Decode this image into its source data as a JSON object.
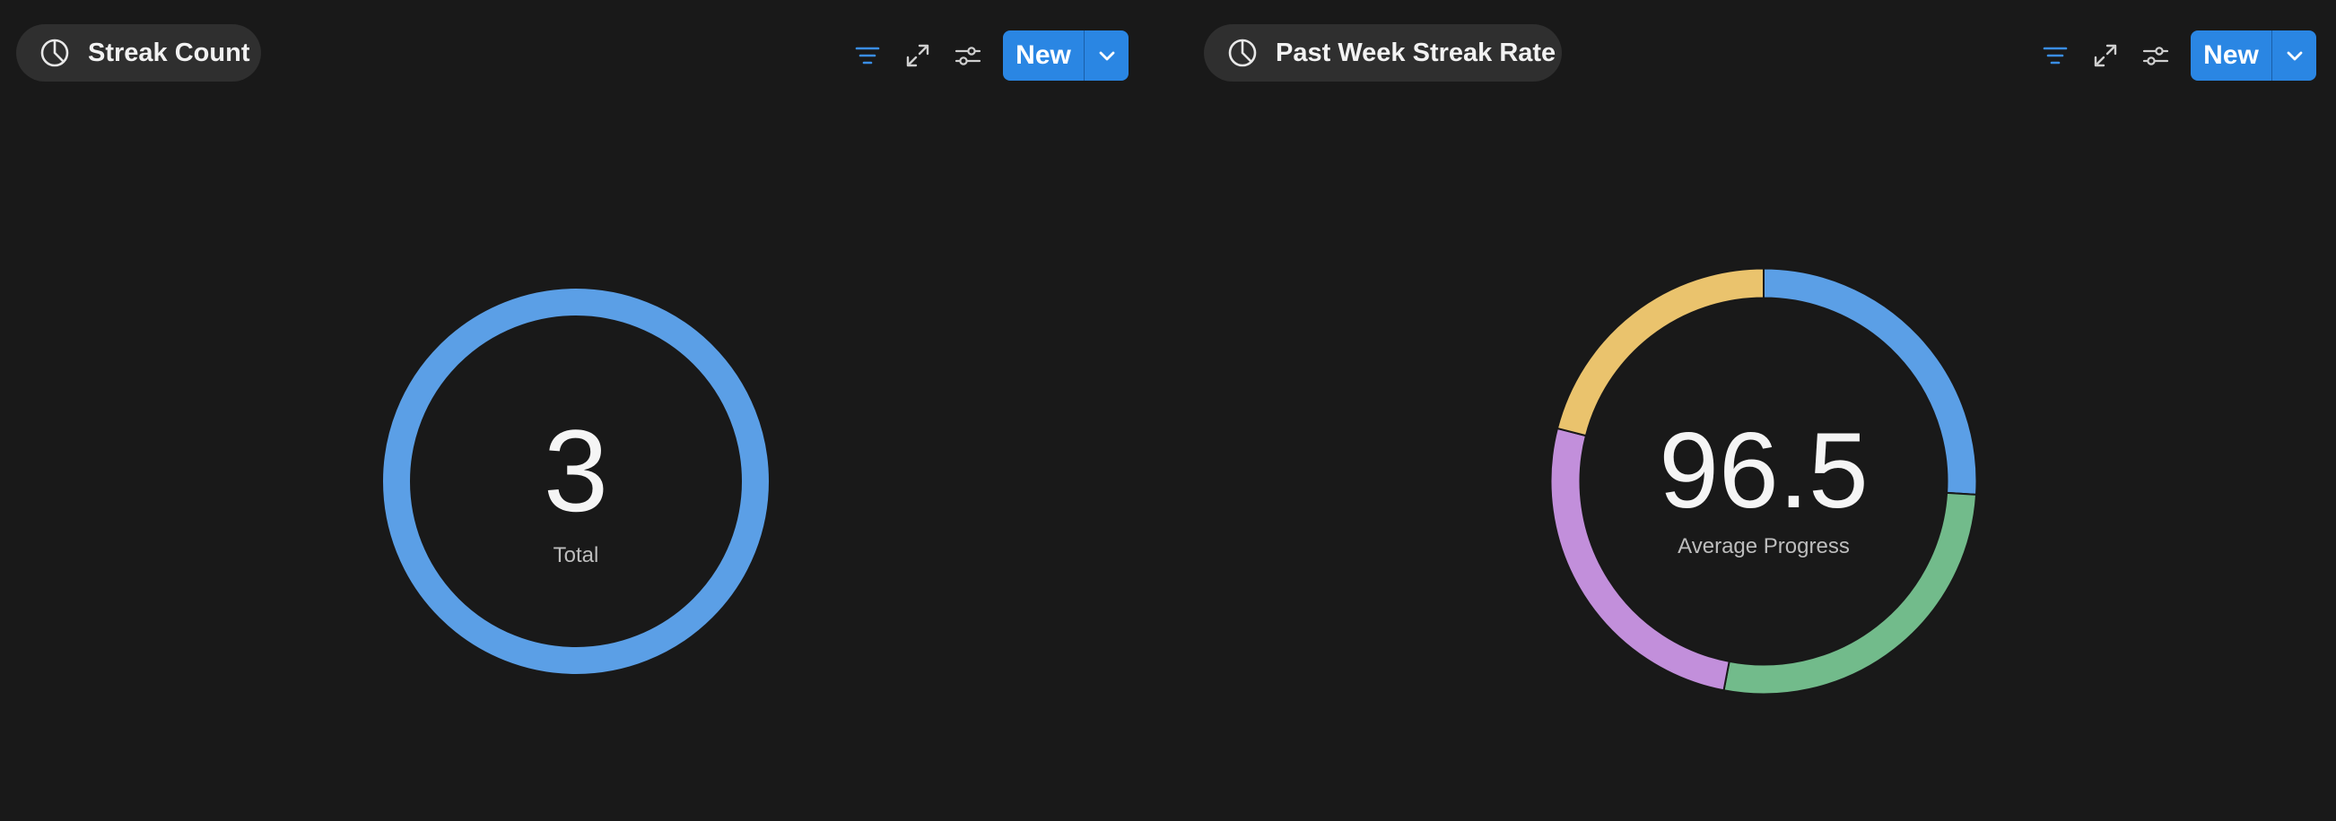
{
  "panels": [
    {
      "title": "Streak Count",
      "toolbar": {
        "new_label": "New"
      },
      "chart_data": {
        "type": "pie",
        "title": "Streak Count",
        "center_value": "3",
        "center_label": "Total",
        "slices": [
          {
            "value": 3,
            "color": "#5b9fe6"
          }
        ]
      }
    },
    {
      "title": "Past Week Streak Rate",
      "toolbar": {
        "new_label": "New"
      },
      "chart_data": {
        "type": "pie",
        "title": "Past Week Streak Rate",
        "center_value": "96.5",
        "center_label": "Average Progress",
        "slices": [
          {
            "value": 26,
            "color": "#5b9fe6"
          },
          {
            "value": 27,
            "color": "#72bb8b"
          },
          {
            "value": 26,
            "color": "#c28fdb"
          },
          {
            "value": 21,
            "color": "#eac36d"
          }
        ]
      }
    }
  ],
  "colors": {
    "background": "#191919",
    "pill": "#2f2f2f",
    "accent": "#2a86e3",
    "filter_icon": "#3a8ee6",
    "muted_icon": "#cfcfcf"
  },
  "icons": {
    "title": "pie-chart-icon",
    "filter": "filter-icon",
    "expand": "expand-icon",
    "settings": "sliders-icon",
    "dropdown": "chevron-down-icon"
  }
}
